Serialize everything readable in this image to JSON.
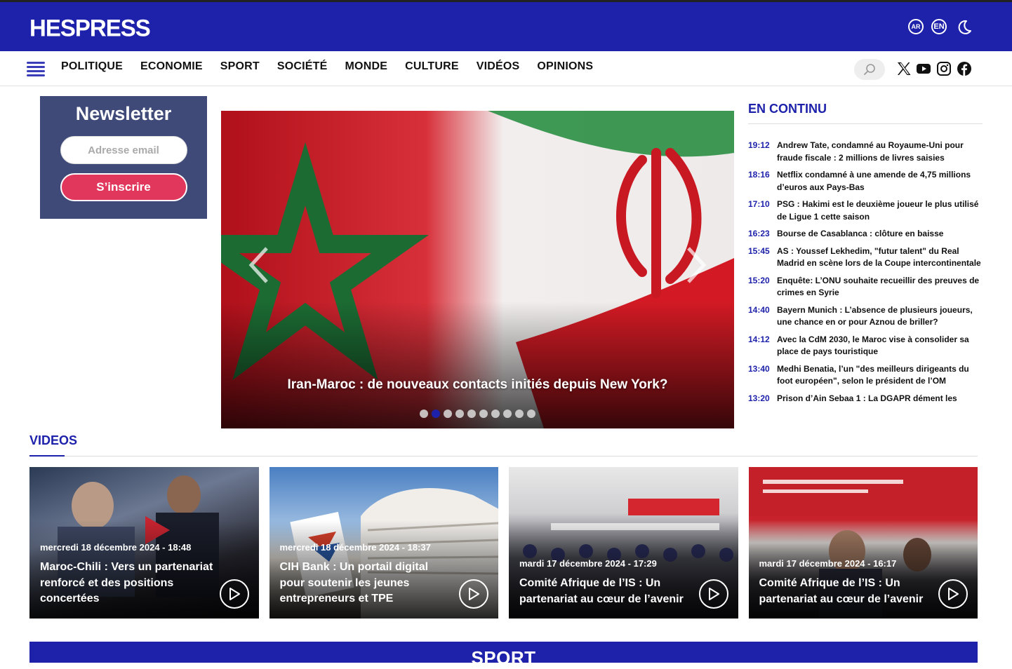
{
  "header": {
    "logo": "HESPRESS",
    "lang_ar": "AR",
    "lang_en": "EN"
  },
  "nav": {
    "items": [
      "POLITIQUE",
      "ECONOMIE",
      "SPORT",
      "SOCIÉTÉ",
      "MONDE",
      "CULTURE",
      "VIDÉOS",
      "OPINIONS"
    ]
  },
  "newsletter": {
    "title": "Newsletter",
    "placeholder": "Adresse email",
    "button": "S’inscrire"
  },
  "hero": {
    "title": "Iran-Maroc : de nouveaux contacts initiés depuis New York?",
    "slide_count": 10,
    "active_slide": 2
  },
  "en_continu": {
    "title": "EN CONTINU",
    "items": [
      {
        "time": "19:12",
        "text": "Andrew Tate, condamné au Royaume-Uni pour fraude fiscale : 2 millions de livres saisies"
      },
      {
        "time": "18:16",
        "text": "Netflix condamné à une amende de 4,75 millions d’euros aux Pays-Bas"
      },
      {
        "time": "17:10",
        "text": "PSG : Hakimi est le deuxième joueur le plus utilisé de Ligue 1 cette saison"
      },
      {
        "time": "16:23",
        "text": "Bourse de Casablanca : clôture en baisse"
      },
      {
        "time": "15:45",
        "text": "AS : Youssef Lekhedim, \"futur talent\" du Real Madrid en scène lors de la Coupe intercontinentale"
      },
      {
        "time": "15:20",
        "text": "Enquête: L’ONU souhaite recueillir des preuves de crimes en Syrie"
      },
      {
        "time": "14:40",
        "text": "Bayern Munich : L’absence de plusieurs joueurs, une chance en or pour Aznou de briller?"
      },
      {
        "time": "14:12",
        "text": "Avec la CdM 2030, le Maroc vise à consolider sa place de pays touristique"
      },
      {
        "time": "13:40",
        "text": "Medhi Benatia, l’un \"des meilleurs dirigeants du foot européen\", selon le président de l’OM"
      },
      {
        "time": "13:20",
        "text": "Prison d’Ain Sebaa 1 : La DGAPR dément les"
      }
    ]
  },
  "videos": {
    "title": "VIDEOS",
    "items": [
      {
        "date": "mercredi 18 décembre 2024 - 18:48",
        "title": "Maroc-Chili : Vers un partenariat renforcé et des positions concertées"
      },
      {
        "date": "mercredi 18 décembre 2024 - 18:37",
        "title": "CIH Bank : Un portail digital pour soutenir les jeunes entrepreneurs et TPE"
      },
      {
        "date": "mardi 17 décembre 2024 - 17:29",
        "title": "Comité Afrique de l’IS : Un partenariat au cœur de l’avenir"
      },
      {
        "date": "mardi 17 décembre 2024 - 16:17",
        "title": "Comité Afrique de l’IS : Un partenariat au cœur de l’avenir"
      }
    ]
  },
  "sport": {
    "title": "SPORT"
  },
  "colors": {
    "brand_blue": "#1e22aa",
    "newsletter_bg": "#3f4a78",
    "subscribe_pink": "#e2375d"
  }
}
